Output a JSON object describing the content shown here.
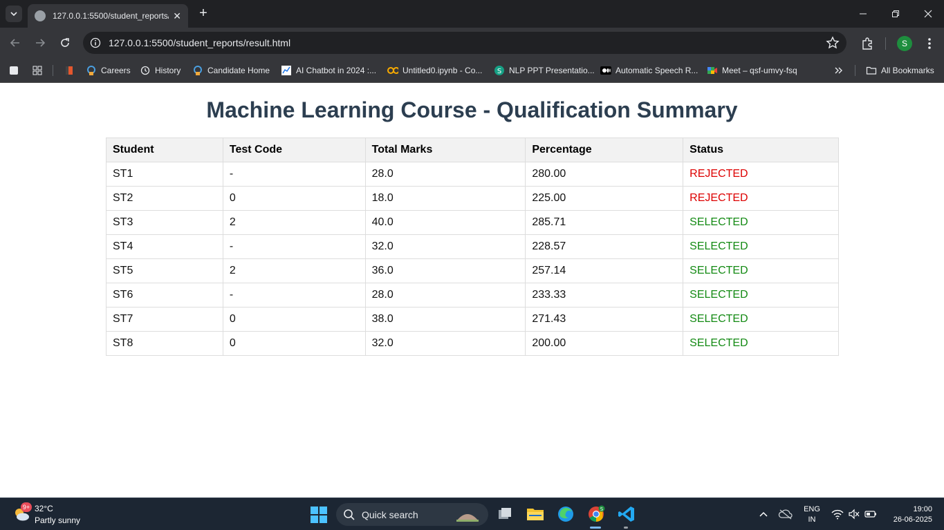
{
  "browser": {
    "tab_title": "127.0.0.1:5500/student_reports/",
    "url": "127.0.0.1:5500/student_reports/result.html",
    "profile_initial": "S"
  },
  "bookmarks": {
    "items": [
      {
        "label": "Careers"
      },
      {
        "label": "History"
      },
      {
        "label": "Candidate Home"
      },
      {
        "label": "AI Chatbot in 2024 :..."
      },
      {
        "label": "Untitled0.ipynb - Co..."
      },
      {
        "label": "NLP PPT Presentatio..."
      },
      {
        "label": "Automatic Speech R..."
      },
      {
        "label": "Meet – qsf-umvy-fsq"
      }
    ],
    "all_bookmarks": "All Bookmarks"
  },
  "page": {
    "title": "Machine Learning Course - Qualification Summary",
    "table": {
      "headers": [
        "Student",
        "Test Code",
        "Total Marks",
        "Percentage",
        "Status"
      ],
      "rows": [
        [
          "ST1",
          "-",
          "28.0",
          "280.00",
          "REJECTED"
        ],
        [
          "ST2",
          "0",
          "18.0",
          "225.00",
          "REJECTED"
        ],
        [
          "ST3",
          "2",
          "40.0",
          "285.71",
          "SELECTED"
        ],
        [
          "ST4",
          "-",
          "32.0",
          "228.57",
          "SELECTED"
        ],
        [
          "ST5",
          "2",
          "36.0",
          "257.14",
          "SELECTED"
        ],
        [
          "ST6",
          "-",
          "28.0",
          "233.33",
          "SELECTED"
        ],
        [
          "ST7",
          "0",
          "38.0",
          "271.43",
          "SELECTED"
        ],
        [
          "ST8",
          "0",
          "32.0",
          "200.00",
          "SELECTED"
        ]
      ]
    },
    "colors": {
      "title": "#2c3e50",
      "rejected": "#dd0000",
      "selected": "#138a13"
    }
  },
  "taskbar": {
    "weather_temp": "32°C",
    "weather_desc": "Partly sunny",
    "weather_badge": "9+",
    "search_placeholder": "Quick search",
    "lang_line1": "ENG",
    "lang_line2": "IN",
    "time": "19:00",
    "date": "26-06-2025"
  }
}
